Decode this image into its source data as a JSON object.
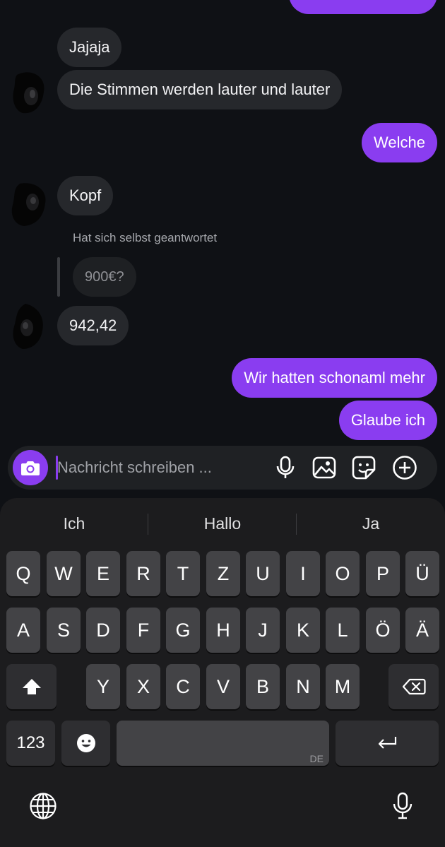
{
  "messages": {
    "in_1": "Jajaja",
    "in_2": "Die Stimmen werden lauter und lauter",
    "out_1": "Welche",
    "in_3": "Kopf",
    "reply_note": "Hat sich selbst geantwortet",
    "quoted": "900€?",
    "in_4": "942,42",
    "out_2": "Wir hatten schonaml mehr",
    "out_3": "Glaube ich"
  },
  "composer": {
    "placeholder": "Nachricht schreiben ..."
  },
  "keyboard": {
    "suggestions": [
      "Ich",
      "Hallo",
      "Ja"
    ],
    "row1": [
      "Q",
      "W",
      "E",
      "R",
      "T",
      "Z",
      "U",
      "I",
      "O",
      "P",
      "Ü"
    ],
    "row2": [
      "A",
      "S",
      "D",
      "F",
      "G",
      "H",
      "J",
      "K",
      "L",
      "Ö",
      "Ä"
    ],
    "row3": [
      "Y",
      "X",
      "C",
      "V",
      "B",
      "N",
      "M"
    ],
    "numbers_key": "123",
    "space_lang": "DE"
  },
  "colors": {
    "accent": "#8a3df0",
    "incoming_bubble": "#26282c",
    "background": "#0f1115",
    "keyboard_bg": "#1c1c1e",
    "key_bg": "#434346"
  },
  "icons": {
    "camera": "camera-icon",
    "composer_mic": "microphone-icon",
    "gallery": "image-icon",
    "sticker": "sticker-icon",
    "plus": "plus-circle-icon",
    "shift": "shift-arrow-icon",
    "backspace": "backspace-icon",
    "emoji": "emoji-icon",
    "return": "return-icon",
    "globe": "globe-icon",
    "dictation": "microphone-icon"
  }
}
